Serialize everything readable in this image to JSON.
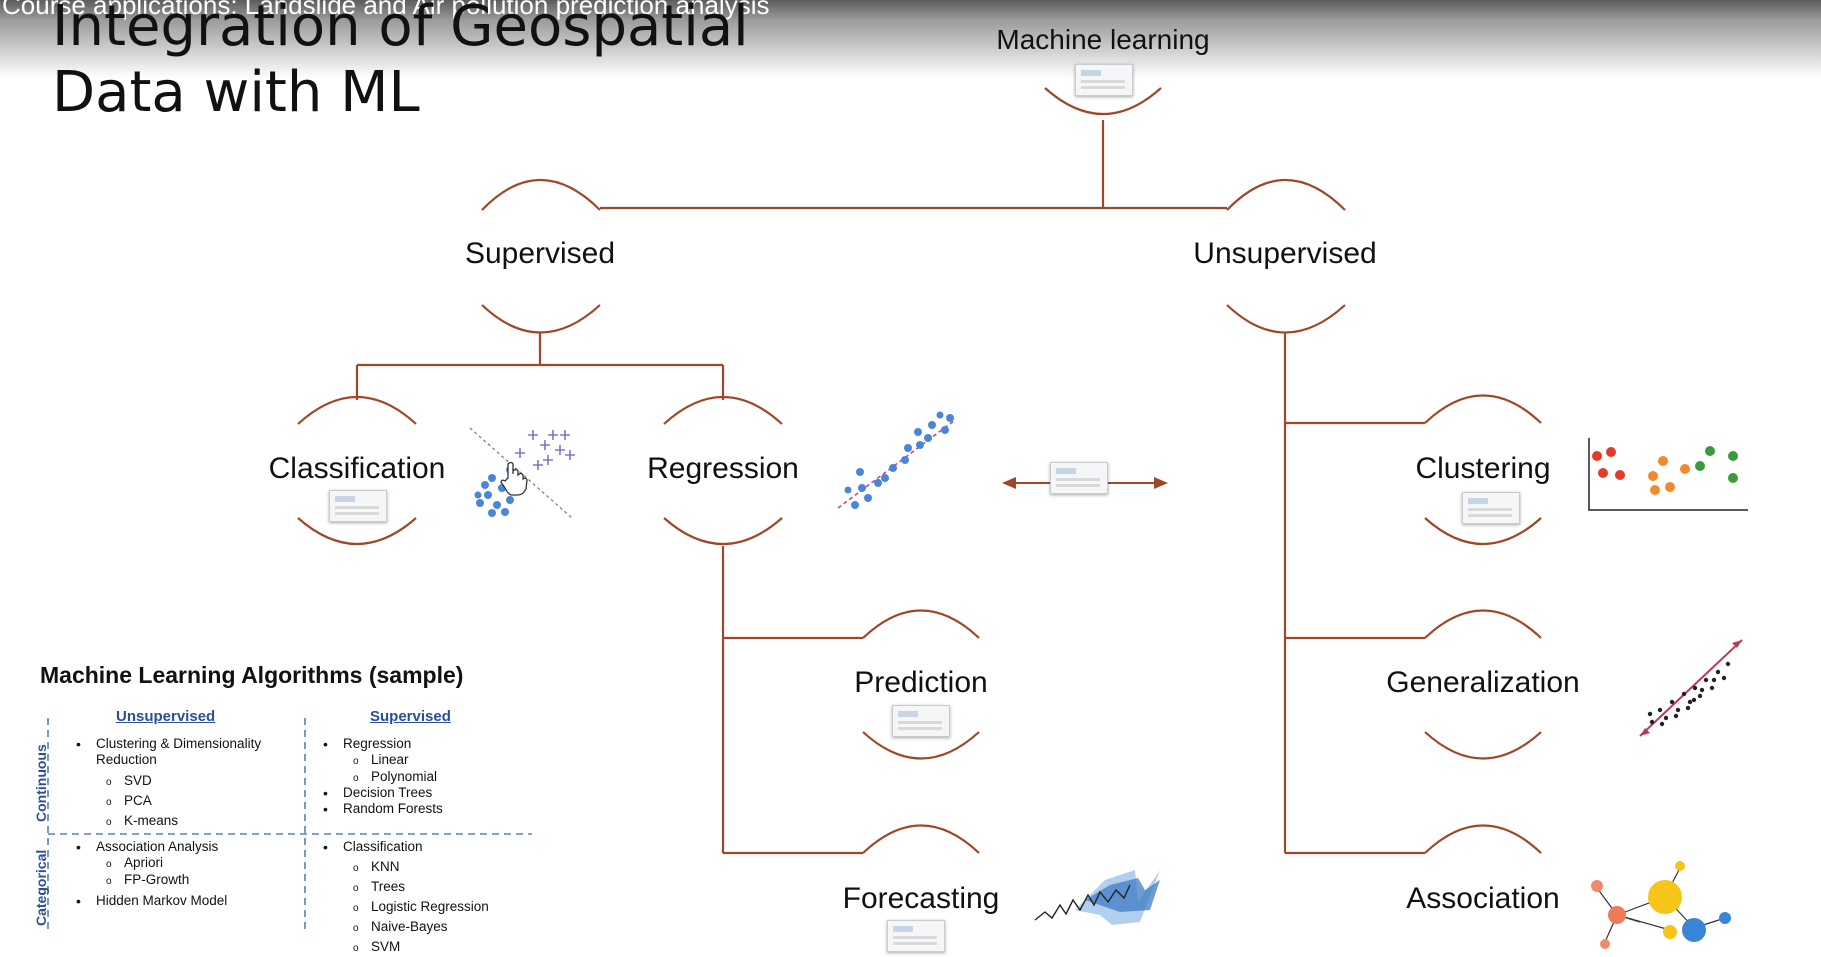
{
  "video": {
    "title": "Course applications: Landslide and Air pollution prediction analysis"
  },
  "slide": {
    "title": "Integration of Geospatial Data with ML"
  },
  "tree": {
    "root": "Machine learning",
    "supervised": "Supervised",
    "unsupervised": "Unsupervised",
    "classification": "Classification",
    "regression": "Regression",
    "prediction": "Prediction",
    "forecasting": "Forecasting",
    "clustering": "Clustering",
    "generalization": "Generalization",
    "association": "Association"
  },
  "colors": {
    "connector": "#a0472a",
    "point_blue": "#4a86d8",
    "point_purple": "#7a78c8",
    "accent_yellow": "#f5c518"
  },
  "icons": [
    "scatter-classification-icon",
    "cursor-hand-icon",
    "regression-scatter-icon",
    "double-arrow-icon",
    "emoji-cluster-icon",
    "generalization-scatter-icon",
    "forecast-line-icon",
    "association-network-icon"
  ],
  "table": {
    "title": "Machine Learning Algorithms (sample)",
    "col_unsupervised": "Unsupervised",
    "col_supervised": "Supervised",
    "row_continuous": "Continuous",
    "row_categorical": "Categorical",
    "unsup_cont": [
      "Clustering & Dimensionality",
      "Reduction",
      "SVD",
      "PCA",
      "K-means"
    ],
    "sup_cont": [
      "Regression",
      "Linear",
      "Polynomial",
      "Decision Trees",
      "Random Forests"
    ],
    "unsup_cat": [
      "Association Analysis",
      "Apriori",
      "FP-Growth",
      "Hidden Markov Model"
    ],
    "sup_cat": [
      "Classification",
      "KNN",
      "Trees",
      "Logistic Regression",
      "Naive-Bayes",
      "SVM"
    ]
  }
}
